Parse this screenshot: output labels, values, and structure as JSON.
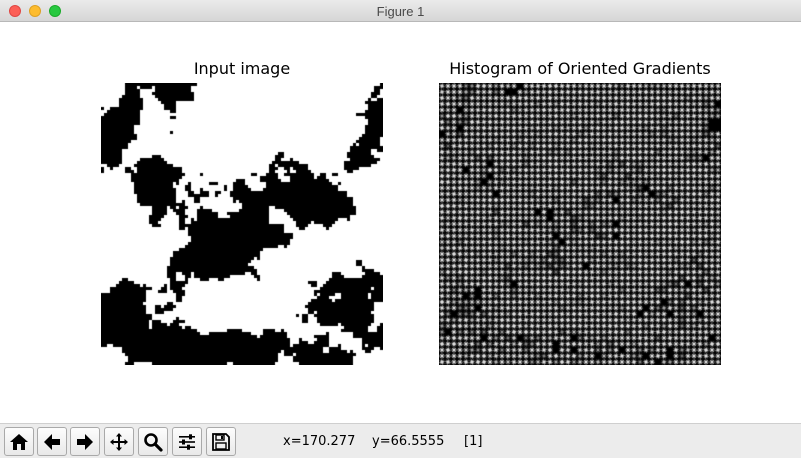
{
  "window": {
    "title": "Figure 1"
  },
  "figure": {
    "left_axes": {
      "title": "Input image",
      "image": "binary-noise-image"
    },
    "right_axes": {
      "title": "Histogram of Oriented Gradients",
      "image": "hog-visualization"
    }
  },
  "toolbar": {
    "buttons": [
      {
        "id": "home",
        "icon": "home-icon"
      },
      {
        "id": "back",
        "icon": "arrow-left-icon"
      },
      {
        "id": "forward",
        "icon": "arrow-right-icon"
      },
      {
        "id": "pan",
        "icon": "move-icon"
      },
      {
        "id": "zoom",
        "icon": "zoom-icon"
      },
      {
        "id": "configure",
        "icon": "sliders-icon"
      },
      {
        "id": "save",
        "icon": "save-icon"
      }
    ],
    "x_readout": "x=170.277",
    "y_readout": "y=66.5555",
    "value_readout": "[1]"
  },
  "colors": {
    "titlebar": "#dcdcdc",
    "close": "#fc5f57",
    "minimize": "#fdbc2e",
    "zoom": "#28c840",
    "image_fg": "#ffffff",
    "image_bg": "#000000"
  }
}
